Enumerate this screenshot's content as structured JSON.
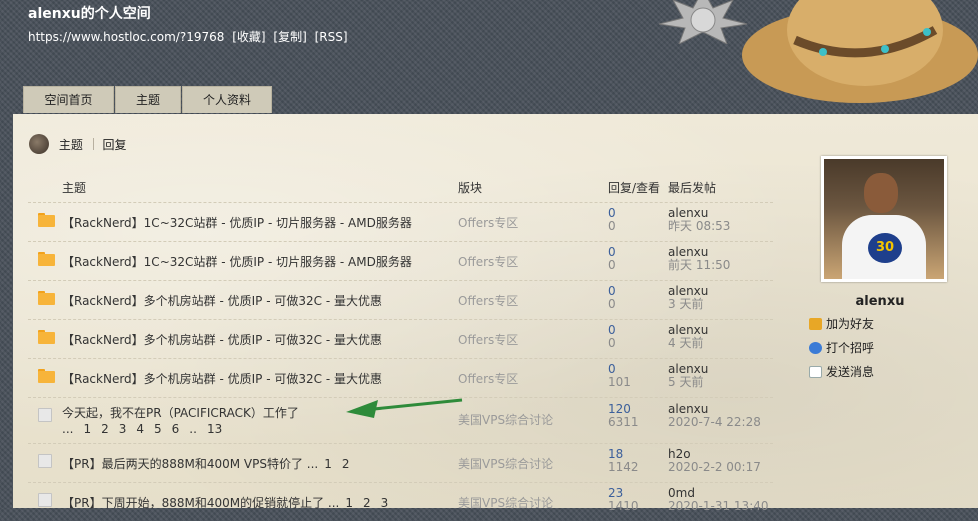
{
  "header": {
    "title": "alenxu的个人空间",
    "url": "https://www.hostloc.com/?19768",
    "links": [
      "[收藏]",
      "[复制]",
      "[RSS]"
    ]
  },
  "tabs": [
    "空间首页",
    "主题",
    "个人资料"
  ],
  "subnav": {
    "tab_topic": "主题",
    "tab_reply": "回复"
  },
  "table": {
    "columns": {
      "subject": "主题",
      "forum": "版块",
      "counts": "回复/查看",
      "last": "最后发帖"
    },
    "rows": [
      {
        "subject": "【RackNerd】1C~32C站群 - 优质IP - 切片服务器 - AMD服务器",
        "forum": "Offers专区",
        "replies": "0",
        "views": "0",
        "last_user": "alenxu",
        "last_time": "昨天 08:53"
      },
      {
        "subject": "【RackNerd】1C~32C站群 - 优质IP - 切片服务器 - AMD服务器",
        "forum": "Offers专区",
        "replies": "0",
        "views": "0",
        "last_user": "alenxu",
        "last_time": "前天 11:50"
      },
      {
        "subject": "【RackNerd】多个机房站群 - 优质IP - 可做32C - 量大优惠",
        "forum": "Offers专区",
        "replies": "0",
        "views": "0",
        "last_user": "alenxu",
        "last_time": "3 天前"
      },
      {
        "subject": "【RackNerd】多个机房站群 - 优质IP - 可做32C - 量大优惠",
        "forum": "Offers专区",
        "replies": "0",
        "views": "0",
        "last_user": "alenxu",
        "last_time": "4 天前"
      },
      {
        "subject": "【RackNerd】多个机房站群 - 优质IP - 可做32C - 量大优惠",
        "forum": "Offers专区",
        "replies": "0",
        "views": "101",
        "last_user": "alenxu",
        "last_time": "5 天前"
      },
      {
        "subject": "今天起，我不在PR（PACIFICRACK）工作了",
        "pages": [
          "...",
          "1",
          "2",
          "3",
          "4",
          "5",
          "6",
          "..",
          "13"
        ],
        "forum": "美国VPS综合讨论",
        "replies": "120",
        "views": "6311",
        "last_user": "alenxu",
        "last_time": "2020-7-4 22:28"
      },
      {
        "subject": "【PR】最后两天的888M和400M VPS特价了 ...",
        "inline_pages": [
          "1",
          "2"
        ],
        "forum": "美国VPS综合讨论",
        "replies": "18",
        "views": "1142",
        "last_user": "h2o",
        "last_time": "2020-2-2 00:17"
      },
      {
        "subject": "【PR】下周开始，888M和400M的促销就停止了 ...",
        "inline_pages": [
          "1",
          "2",
          "3"
        ],
        "forum": "美国VPS综合讨论",
        "replies": "23",
        "views": "1410",
        "last_user": "0md",
        "last_time": "2020-1-31 13:40"
      }
    ]
  },
  "profile": {
    "username": "alenxu",
    "jersey_number": "30",
    "add_friend": "加为好友",
    "poke": "打个招呼",
    "send_message": "发送消息"
  },
  "colors": {
    "accent_arrow": "#2e8b3a",
    "reply_count": "#3b5f9b",
    "folder": "#f7b43a"
  }
}
